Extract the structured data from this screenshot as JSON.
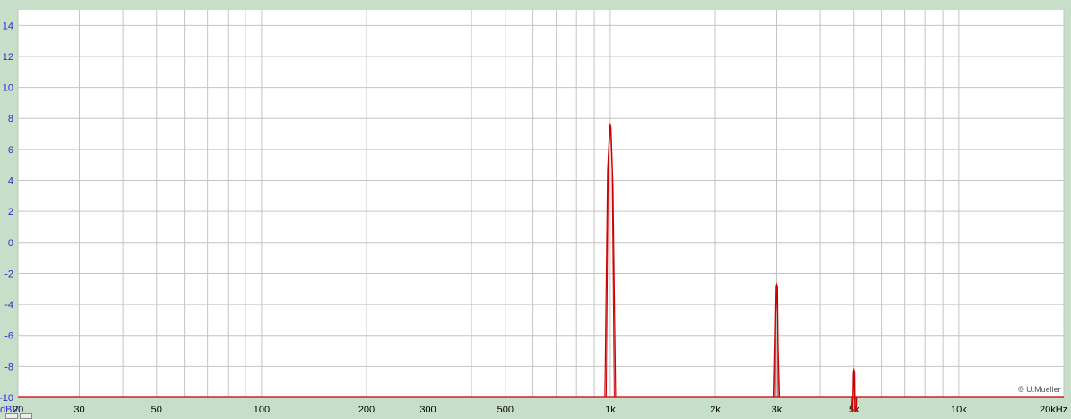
{
  "chart_data": {
    "type": "line",
    "xscale": "log",
    "xlim": [
      20,
      20000
    ],
    "ylim": [
      -10,
      15
    ],
    "grid": true,
    "y_unit_label": "dBV",
    "x_unit_label": "20kHz",
    "yticks": [
      "14",
      "12",
      "10",
      "8",
      "6",
      "4",
      "2",
      "0",
      "-2",
      "-4",
      "-6",
      "-8",
      "-10"
    ],
    "xticks": [
      "20",
      "30",
      "50",
      "100",
      "200",
      "300",
      "500",
      "1k",
      "2k",
      "3k",
      "5k",
      "10k"
    ],
    "series": [
      {
        "color": "#cc0000",
        "peaks": [
          {
            "x": 1000,
            "y": 7.6
          },
          {
            "x": 3000,
            "y": -2.7
          },
          {
            "x": 5000,
            "y": -8.2
          }
        ]
      }
    ],
    "credit": "© U.Mueller"
  }
}
